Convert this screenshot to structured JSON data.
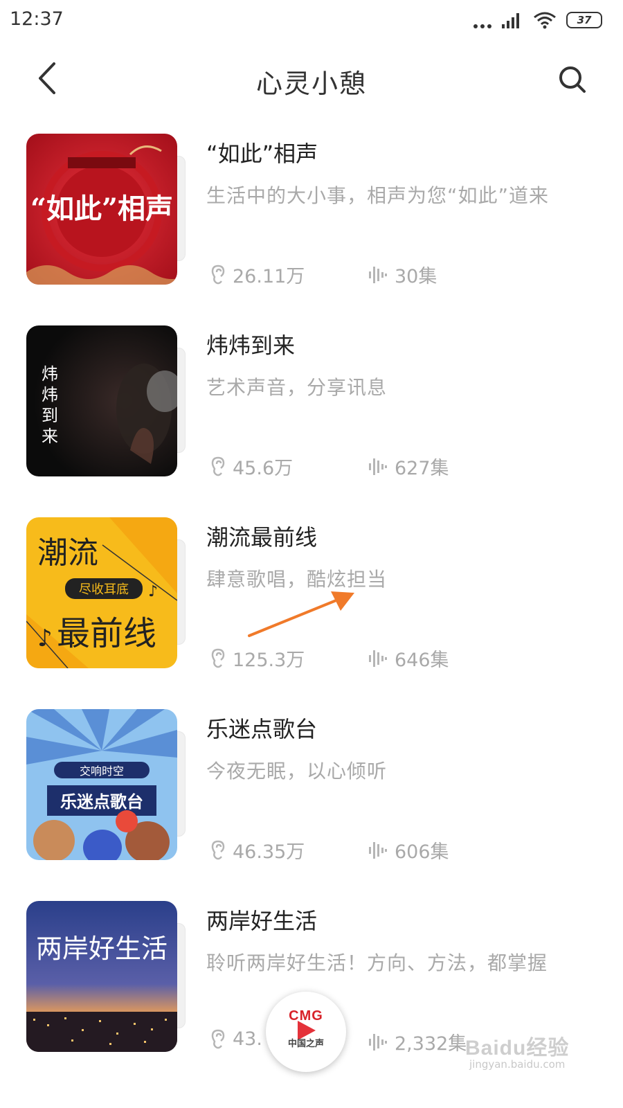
{
  "status_bar": {
    "time": "12:37",
    "battery": "37",
    "icons": [
      "more-dots-icon",
      "signal-icon",
      "wifi-icon",
      "battery-icon"
    ]
  },
  "header": {
    "title": "心灵小憩",
    "back_icon": "chevron-left-icon",
    "search_icon": "search-icon"
  },
  "items": [
    {
      "title": "“如此”相声",
      "desc": "生活中的大小事，相声为您“如此”道来",
      "plays": "26.11万",
      "episodes": "30集",
      "cover_text": "“如此”相声"
    },
    {
      "title": "炜炜到来",
      "desc": "艺术声音，分享讯息",
      "plays": "45.6万",
      "episodes": "627集",
      "cover_text": "炜炜到来"
    },
    {
      "title": "潮流最前线",
      "desc": "肆意歌唱，酷炫担当",
      "plays": "125.3万",
      "episodes": "646集",
      "cover_text_top": "潮流",
      "cover_badge": "尽收耳底",
      "cover_text_bottom": "最前线"
    },
    {
      "title": "乐迷点歌台",
      "desc": "今夜无眠，以心倾听",
      "plays": "46.35万",
      "episodes": "606集",
      "cover_badge": "交响时空",
      "cover_text": "乐迷点歌台"
    },
    {
      "title": "两岸好生活",
      "desc": "聆听两岸好生活！方向、方法，都掌握",
      "plays": "43.",
      "episodes": "2,332集",
      "cover_text": "两岸好生活"
    }
  ],
  "player": {
    "logo": "CMG",
    "subtitle": "中国之声"
  },
  "watermark": {
    "text": "Baidu经验",
    "url": "jingyan.baidu.com"
  },
  "colors": {
    "accent_arrow": "#f07a2a",
    "muted_text": "#a9a9a9"
  }
}
